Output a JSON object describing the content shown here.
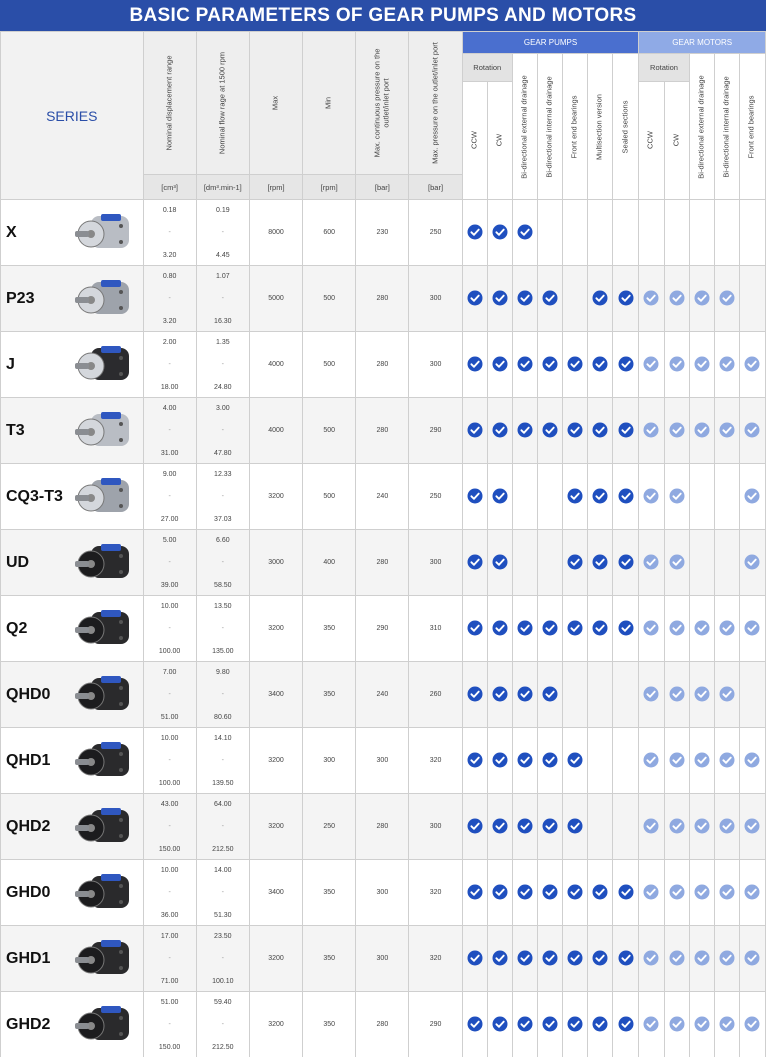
{
  "title": "BASIC PARAMETERS OF GEAR PUMPS AND MOTORS",
  "header": {
    "series": "SERIES",
    "columns": [
      {
        "label": "Nominal displacement range",
        "unit": "[cm³]"
      },
      {
        "label": "Nominal flow rage at 1500 rpm",
        "unit": "[dm³.min-1]"
      },
      {
        "label": "Max",
        "unit": "[rpm]"
      },
      {
        "label": "Min",
        "unit": "[rpm]"
      },
      {
        "label": "Max. continuous pressure on the outlet/inlet port",
        "unit": "[bar]"
      },
      {
        "label": "Max. pressure on the outlet/inlet port",
        "unit": "[bar]"
      }
    ],
    "pumps_group": "GEAR PUMPS",
    "motors_group": "GEAR MOTORS",
    "rotation": "Rotation",
    "pump_features": [
      "CCW",
      "CW",
      "Bi-directional external drainage",
      "Bi-directional internal drainage",
      "Front end bearings",
      "Multisection version",
      "Sealed sections"
    ],
    "motor_features": [
      "CCW",
      "CW",
      "Bi-directional external drainage",
      "Bi-directional internal drainage",
      "Front end bearings"
    ]
  },
  "colors": {
    "title_bg": "#2a4ea8",
    "pumps_header": "#4a6fcf",
    "motors_header": "#8faae6",
    "pump_check": "#1f4fbf",
    "motor_check": "#8fa9e0"
  },
  "rows": [
    {
      "series": "X",
      "disp_min": "0.18",
      "disp_max": "3.20",
      "flow_min": "0.19",
      "flow_max": "4.45",
      "rpm_max": "8000",
      "rpm_min": "600",
      "p_cont": "230",
      "p_max": "250",
      "pumps": [
        1,
        1,
        1,
        0,
        0,
        0,
        0
      ],
      "motors": [
        0,
        0,
        0,
        0,
        0
      ]
    },
    {
      "series": "P23",
      "disp_min": "0.80",
      "disp_max": "3.20",
      "flow_min": "1.07",
      "flow_max": "16.30",
      "rpm_max": "5000",
      "rpm_min": "500",
      "p_cont": "280",
      "p_max": "300",
      "pumps": [
        1,
        1,
        1,
        1,
        0,
        1,
        1
      ],
      "motors": [
        1,
        1,
        1,
        1,
        0
      ]
    },
    {
      "series": "J",
      "disp_min": "2.00",
      "disp_max": "18.00",
      "flow_min": "1.35",
      "flow_max": "24.80",
      "rpm_max": "4000",
      "rpm_min": "500",
      "p_cont": "280",
      "p_max": "300",
      "pumps": [
        1,
        1,
        1,
        1,
        1,
        1,
        1
      ],
      "motors": [
        1,
        1,
        1,
        1,
        1
      ]
    },
    {
      "series": "T3",
      "disp_min": "4.00",
      "disp_max": "31.00",
      "flow_min": "3.00",
      "flow_max": "47.80",
      "rpm_max": "4000",
      "rpm_min": "500",
      "p_cont": "280",
      "p_max": "290",
      "pumps": [
        1,
        1,
        1,
        1,
        1,
        1,
        1
      ],
      "motors": [
        1,
        1,
        1,
        1,
        1
      ]
    },
    {
      "series": "CQ3-T3",
      "disp_min": "9.00",
      "disp_max": "27.00",
      "flow_min": "12.33",
      "flow_max": "37.03",
      "rpm_max": "3200",
      "rpm_min": "500",
      "p_cont": "240",
      "p_max": "250",
      "pumps": [
        1,
        1,
        0,
        0,
        1,
        1,
        1
      ],
      "motors": [
        1,
        1,
        0,
        0,
        1
      ]
    },
    {
      "series": "UD",
      "disp_min": "5.00",
      "disp_max": "39.00",
      "flow_min": "6.60",
      "flow_max": "58.50",
      "rpm_max": "3000",
      "rpm_min": "400",
      "p_cont": "280",
      "p_max": "300",
      "pumps": [
        1,
        1,
        0,
        0,
        1,
        1,
        1
      ],
      "motors": [
        1,
        1,
        0,
        0,
        1
      ]
    },
    {
      "series": "Q2",
      "disp_min": "10.00",
      "disp_max": "100.00",
      "flow_min": "13.50",
      "flow_max": "135.00",
      "rpm_max": "3200",
      "rpm_min": "350",
      "p_cont": "290",
      "p_max": "310",
      "pumps": [
        1,
        1,
        1,
        1,
        1,
        1,
        1
      ],
      "motors": [
        1,
        1,
        1,
        1,
        1
      ]
    },
    {
      "series": "QHD0",
      "disp_min": "7.00",
      "disp_max": "51.00",
      "flow_min": "9.80",
      "flow_max": "80.60",
      "rpm_max": "3400",
      "rpm_min": "350",
      "p_cont": "240",
      "p_max": "260",
      "pumps": [
        1,
        1,
        1,
        1,
        0,
        0,
        0
      ],
      "motors": [
        1,
        1,
        1,
        1,
        0
      ]
    },
    {
      "series": "QHD1",
      "disp_min": "10.00",
      "disp_max": "100.00",
      "flow_min": "14.10",
      "flow_max": "139.50",
      "rpm_max": "3200",
      "rpm_min": "300",
      "p_cont": "300",
      "p_max": "320",
      "pumps": [
        1,
        1,
        1,
        1,
        1,
        0,
        0
      ],
      "motors": [
        1,
        1,
        1,
        1,
        1
      ]
    },
    {
      "series": "QHD2",
      "disp_min": "43.00",
      "disp_max": "150.00",
      "flow_min": "64.00",
      "flow_max": "212.50",
      "rpm_max": "3200",
      "rpm_min": "250",
      "p_cont": "280",
      "p_max": "300",
      "pumps": [
        1,
        1,
        1,
        1,
        1,
        0,
        0
      ],
      "motors": [
        1,
        1,
        1,
        1,
        1
      ]
    },
    {
      "series": "GHD0",
      "disp_min": "10.00",
      "disp_max": "36.00",
      "flow_min": "14.00",
      "flow_max": "51.30",
      "rpm_max": "3400",
      "rpm_min": "350",
      "p_cont": "300",
      "p_max": "320",
      "pumps": [
        1,
        1,
        1,
        1,
        1,
        1,
        1
      ],
      "motors": [
        1,
        1,
        1,
        1,
        1
      ]
    },
    {
      "series": "GHD1",
      "disp_min": "17.00",
      "disp_max": "71.00",
      "flow_min": "23.50",
      "flow_max": "100.10",
      "rpm_max": "3200",
      "rpm_min": "350",
      "p_cont": "300",
      "p_max": "320",
      "pumps": [
        1,
        1,
        1,
        1,
        1,
        1,
        1
      ],
      "motors": [
        1,
        1,
        1,
        1,
        1
      ]
    },
    {
      "series": "GHD2",
      "disp_min": "51.00",
      "disp_max": "150.00",
      "flow_min": "59.40",
      "flow_max": "212.50",
      "rpm_max": "3200",
      "rpm_min": "350",
      "p_cont": "280",
      "p_max": "290",
      "pumps": [
        1,
        1,
        1,
        1,
        1,
        1,
        1
      ],
      "motors": [
        1,
        1,
        1,
        1,
        1
      ]
    }
  ]
}
